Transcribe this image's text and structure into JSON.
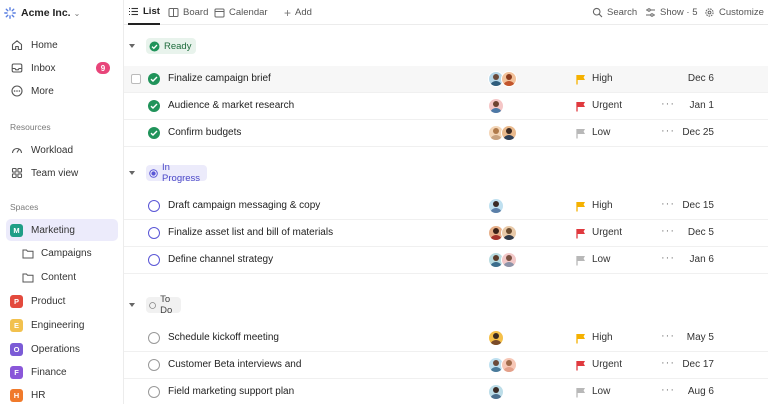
{
  "workspace": {
    "name": "Acme Inc."
  },
  "sidebar": {
    "nav": [
      {
        "label": "Home",
        "icon": "home-icon"
      },
      {
        "label": "Inbox",
        "icon": "inbox-icon",
        "badge": "9"
      },
      {
        "label": "More",
        "icon": "more-icon"
      }
    ],
    "resources_label": "Resources",
    "resources": [
      {
        "label": "Workload",
        "icon": "gauge-icon"
      },
      {
        "label": "Team view",
        "icon": "grid-icon"
      }
    ],
    "spaces_label": "Spaces",
    "spaces": [
      {
        "letter": "M",
        "label": "Marketing",
        "color": "#1f9e86"
      },
      {
        "letter": "P",
        "label": "Product",
        "color": "#e34a3d"
      },
      {
        "letter": "E",
        "label": "Engineering",
        "color": "#f2c14e"
      },
      {
        "letter": "O",
        "label": "Operations",
        "color": "#7b5bd6"
      },
      {
        "letter": "F",
        "label": "Finance",
        "color": "#8a57d9"
      },
      {
        "letter": "H",
        "label": "HR",
        "color": "#f07a2b"
      }
    ],
    "folders": [
      {
        "label": "Campaigns"
      },
      {
        "label": "Content"
      }
    ]
  },
  "toolbar": {
    "list": "List",
    "board": "Board",
    "calendar": "Calendar",
    "add": "Add",
    "search": "Search",
    "show": "Show · 5",
    "customize": "Customize"
  },
  "groups": [
    {
      "status": "Ready",
      "tasks": [
        {
          "title": "Finalize campaign brief",
          "priority": "High",
          "due": "Dec 6"
        },
        {
          "title": "Audience & market research",
          "priority": "Urgent",
          "due": "Jan 1"
        },
        {
          "title": "Confirm budgets",
          "priority": "Low",
          "due": "Dec 25"
        }
      ]
    },
    {
      "status": "In Progress",
      "tasks": [
        {
          "title": "Draft campaign messaging & copy",
          "priority": "High",
          "due": "Dec 15"
        },
        {
          "title": "Finalize asset list and bill of materials",
          "priority": "Urgent",
          "due": "Dec 5"
        },
        {
          "title": "Define channel strategy",
          "priority": "Low",
          "due": "Jan 6"
        }
      ]
    },
    {
      "status": "To Do",
      "tasks": [
        {
          "title": "Schedule kickoff meeting",
          "priority": "High",
          "due": "May 5"
        },
        {
          "title": "Customer Beta interviews and",
          "priority": "Urgent",
          "due": "Dec 17"
        },
        {
          "title": "Field marketing support plan",
          "priority": "Low",
          "due": "Aug 6"
        }
      ]
    }
  ],
  "colors": {
    "high": "#f5b100",
    "urgent": "#e0393e",
    "low": "#b8b8b8",
    "accent": "#5a56d6"
  }
}
